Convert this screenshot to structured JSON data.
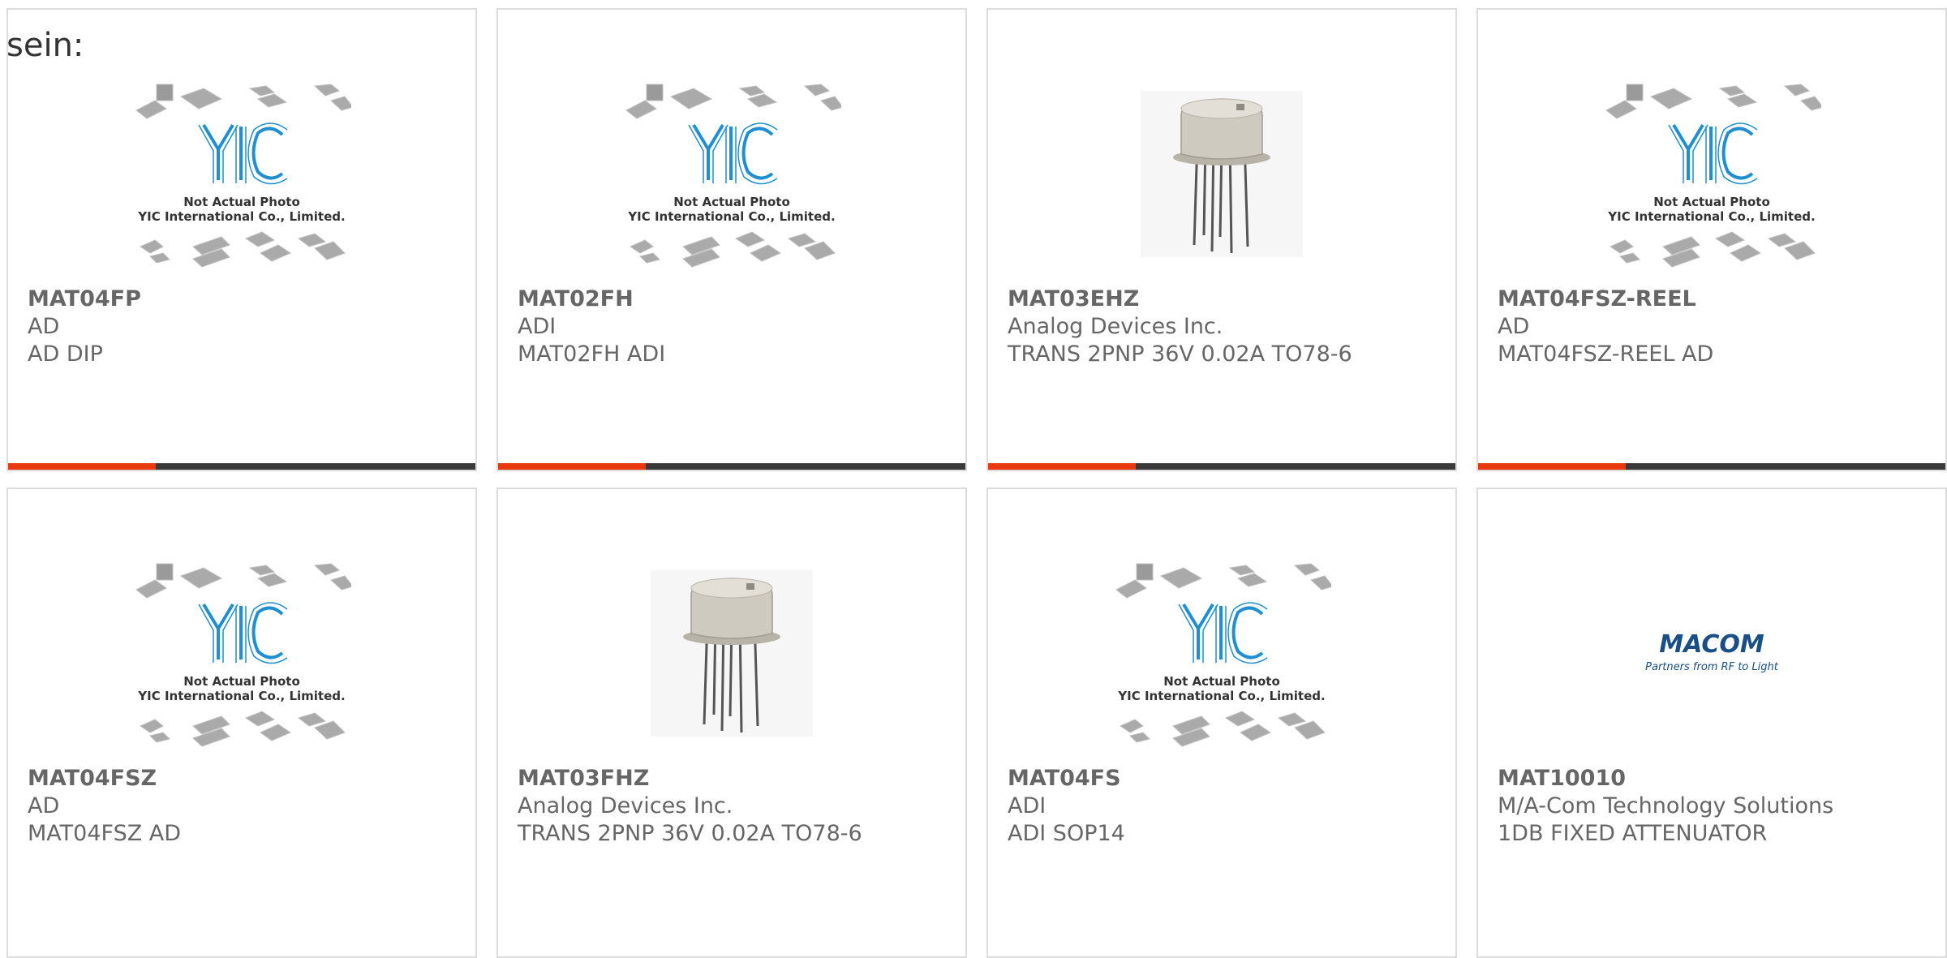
{
  "lead_text": "sein:",
  "placeholder_image": {
    "logo_text": "YIC",
    "caption_line1": "Not Actual Photo",
    "caption_line2": "YIC International Co., Limited."
  },
  "macom_logo": {
    "brand": "MACOM",
    "tagline": "Partners from RF to Light"
  },
  "colors": {
    "accent": "#e8380d",
    "bar_dark": "#3a3a3a",
    "card_border": "#dcdcdc",
    "yic_blue": "#1f8fd1"
  },
  "products": [
    {
      "part": "MAT04FP",
      "maker": "AD",
      "desc": "AD DIP",
      "image": "yic-placeholder"
    },
    {
      "part": "MAT02FH",
      "maker": "ADI",
      "desc": "MAT02FH ADI",
      "image": "yic-placeholder"
    },
    {
      "part": "MAT03EHZ",
      "maker": "Analog Devices Inc.",
      "desc": "TRANS 2PNP 36V 0.02A TO78-6",
      "image": "to78-can"
    },
    {
      "part": "MAT04FSZ-REEL",
      "maker": "AD",
      "desc": "MAT04FSZ-REEL AD",
      "image": "yic-placeholder"
    },
    {
      "part": "MAT04FSZ",
      "maker": "AD",
      "desc": "MAT04FSZ AD",
      "image": "yic-placeholder"
    },
    {
      "part": "MAT03FHZ",
      "maker": "Analog Devices Inc.",
      "desc": "TRANS 2PNP 36V 0.02A TO78-6",
      "image": "to78-can"
    },
    {
      "part": "MAT04FS",
      "maker": "ADI",
      "desc": "ADI SOP14",
      "image": "yic-placeholder"
    },
    {
      "part": "MAT10010",
      "maker": "M/A-Com Technology Solutions",
      "desc": "1DB FIXED ATTENUATOR",
      "image": "macom-logo"
    }
  ]
}
